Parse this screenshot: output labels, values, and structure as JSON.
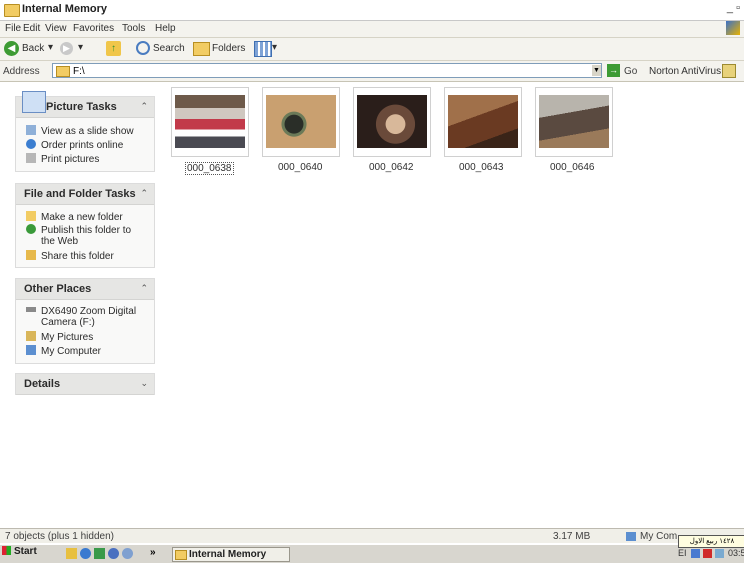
{
  "window": {
    "title": "Internal Memory",
    "controls": "_ &#"
  },
  "menu": [
    "File",
    "Edit",
    "View",
    "Favorites",
    "Tools",
    "Help"
  ],
  "toolbar": {
    "back": "Back",
    "search": "Search",
    "folders": "Folders"
  },
  "address": {
    "label": "Address",
    "value": "F:\\",
    "go": "Go",
    "norton": "Norton AntiVirus"
  },
  "panes": {
    "picture_tasks": {
      "title": "Picture Tasks",
      "items": [
        "View as a slide show",
        "Order prints online",
        "Print pictures"
      ]
    },
    "file_tasks": {
      "title": "File and Folder Tasks",
      "items": [
        "Make a new folder",
        "Publish this folder to",
        "the Web",
        "Share this folder"
      ]
    },
    "other_places": {
      "title": "Other Places",
      "items": [
        "DX6490 Zoom Digital",
        "Camera (F:)",
        "My Pictures",
        "My Computer"
      ]
    },
    "details": {
      "title": "Details"
    }
  },
  "files": [
    "000_0638",
    "000_0640",
    "000_0642",
    "000_0643",
    "000_0646"
  ],
  "status": {
    "objects": "7 objects (plus 1 hidden)",
    "size": "3.17 MB",
    "location": "My Com"
  },
  "taskbar": {
    "start": "Start",
    "task": "Internal Memory",
    "lang": "EI",
    "clock": "03:59"
  },
  "tooltip": "١٤٢٨ ربيع الاول"
}
